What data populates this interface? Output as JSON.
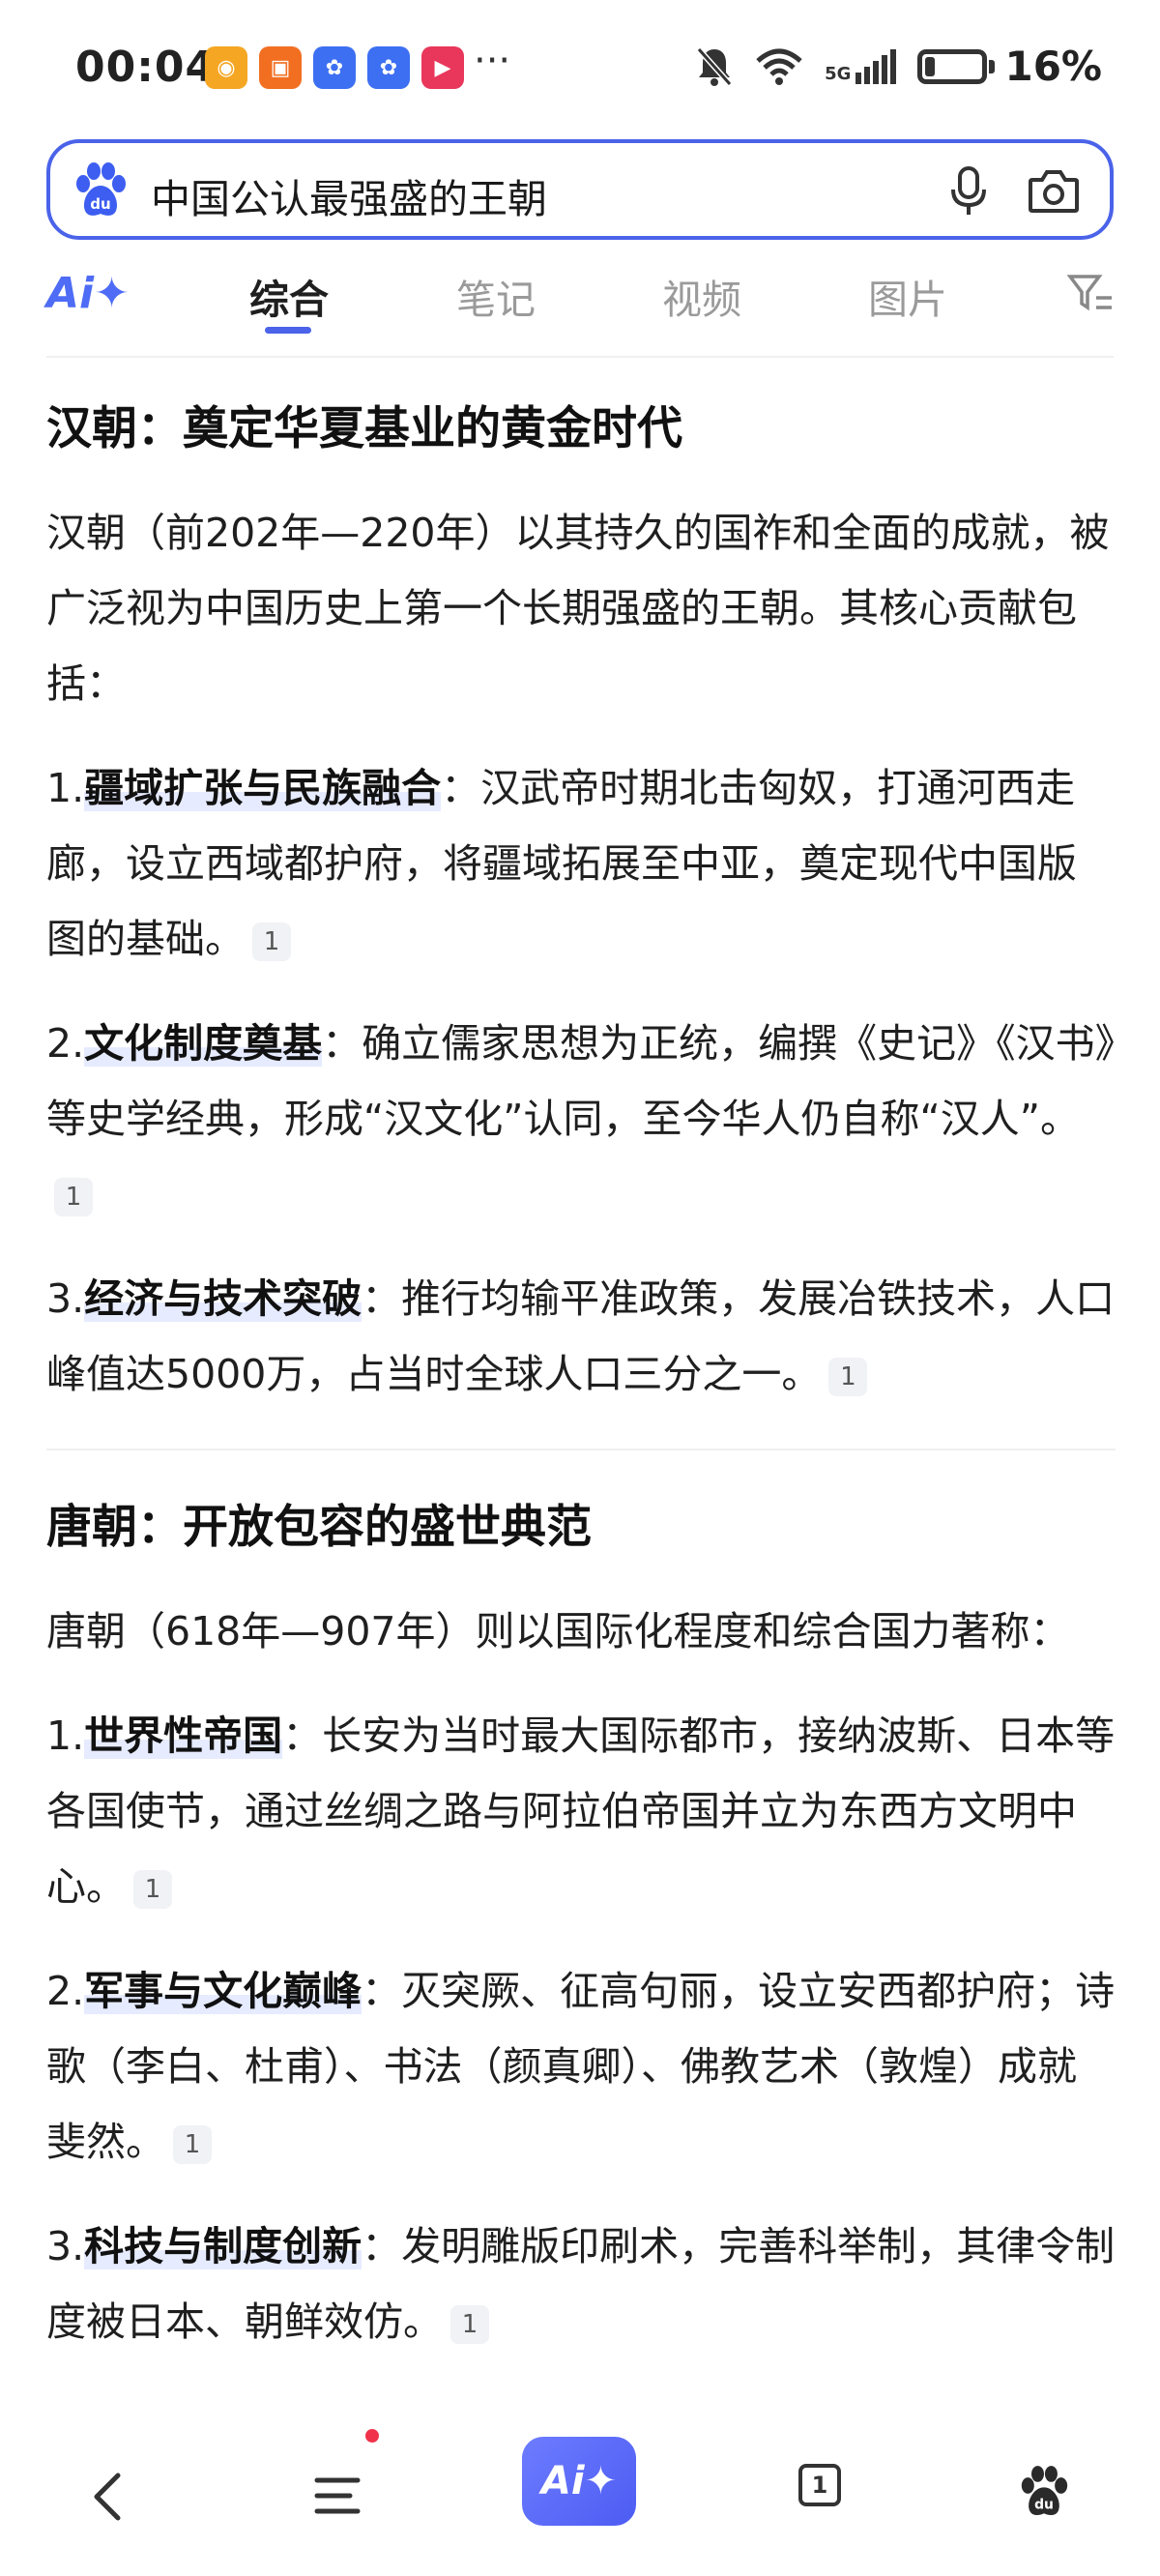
{
  "status_bar": {
    "time": "00:04",
    "battery": "16%",
    "network": "5G",
    "more": "···",
    "apps": [
      {
        "icon": "weibo-icon",
        "color": "#f5a623"
      },
      {
        "icon": "xiaohongshu-icon",
        "color": "#f26f22"
      },
      {
        "icon": "baidu-app-icon",
        "color": "#3d6ff2"
      },
      {
        "icon": "baidu-lite-icon",
        "color": "#3d6ff2"
      },
      {
        "icon": "video-app-icon",
        "color": "#e8375a"
      }
    ]
  },
  "search": {
    "query": "中国公认最强盛的王朝",
    "logo": "baidu-paw-icon",
    "mic": "mic-icon",
    "camera": "camera-icon"
  },
  "tabs": {
    "ai": "Ai✦",
    "items": [
      "综合",
      "笔记",
      "视频",
      "图片"
    ],
    "active": "综合",
    "filter": "filter-icon",
    "accent": "#4a63e9"
  },
  "content": {
    "han": {
      "title": "汉朝：奠定华夏基业的黄金时代",
      "intro": "汉朝（前202年—220年）以其持久的国祚和全面的成就，被广泛视为中国历史上第一个长期强盛的王朝。其核心贡献包括：",
      "items": [
        {
          "num": "1.",
          "key": "疆域扩张与民族融合",
          "text": "：汉武帝时期北击匈奴，打通河西走廊，设立西域都护府，将疆域拓展至中亚，奠定现代中国版图的基础。",
          "cite": "1"
        },
        {
          "num": "2.",
          "key": "文化制度奠基",
          "text": "：确立儒家思想为正统，编撰《史记》《汉书》等史学经典，形成“汉文化”认同，至今华人仍自称“汉人”。",
          "cite": "1"
        },
        {
          "num": "3.",
          "key": "经济与技术突破",
          "text": "：推行均输平准政策，发展冶铁技术，人口峰值达5000万，占当时全球人口三分之一。",
          "cite": "1"
        }
      ]
    },
    "tang": {
      "title": "唐朝：开放包容的盛世典范",
      "intro": "唐朝（618年—907年）则以国际化程度和综合国力著称：",
      "items": [
        {
          "num": "1.",
          "key": "世界性帝国",
          "text": "：长安为当时最大国际都市，接纳波斯、日本等各国使节，通过丝绸之路与阿拉伯帝国并立为东西方文明中心。",
          "cite": "1"
        },
        {
          "num": "2.",
          "key": "军事与文化巅峰",
          "text": "：灭突厥、征高句丽，设立安西都护府；诗歌（李白、杜甫）、书法（颜真卿）、佛教艺术（敦煌）成就斐然。",
          "cite": "1"
        },
        {
          "num": "3.",
          "key": "科技与制度创新",
          "text": "：发明雕版印刷术，完善科举制，其律令制度被日本、朝鲜效仿。",
          "cite": "1"
        }
      ]
    }
  },
  "bottom_nav": {
    "back": "back-icon",
    "menu": "menu-icon",
    "ai_button": "Ai✦",
    "tabs_count": "1",
    "home": "baidu-paw-icon"
  }
}
